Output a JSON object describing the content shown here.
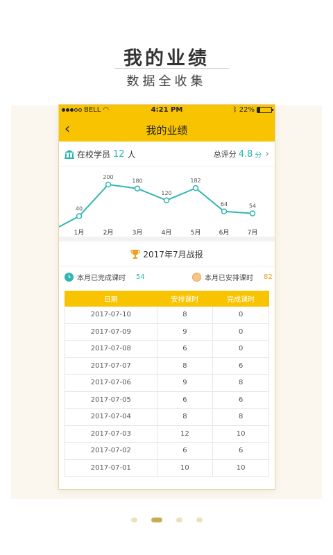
{
  "hero": {
    "title": "我的业绩",
    "subtitle": "数据全收集"
  },
  "status_bar": {
    "carrier": "BELL",
    "time": "4:21 PM",
    "battery": "22%",
    "battery_level": 0.22
  },
  "nav": {
    "title": "我的业绩"
  },
  "summary": {
    "students_label": "在校学员",
    "students_count": "12",
    "students_unit": "人",
    "score_label": "总评分",
    "score_value": "4.8",
    "score_unit": "分"
  },
  "chart_data": {
    "type": "line",
    "categories": [
      "1月",
      "2月",
      "3月",
      "4月",
      "5月",
      "6月",
      "7月"
    ],
    "values": [
      40,
      200,
      180,
      120,
      182,
      64,
      54
    ],
    "color": "#2fb6b0"
  },
  "report": {
    "title": "2017年7月战报"
  },
  "stats": {
    "completed_label": "本月已完成课时",
    "completed_value": "54",
    "scheduled_label": "本月已安排课时",
    "scheduled_value": "82"
  },
  "table": {
    "headers": [
      "日期",
      "安排课时",
      "完成课时"
    ],
    "rows": [
      [
        "2017-07-10",
        "8",
        "0"
      ],
      [
        "2017-07-09",
        "9",
        "0"
      ],
      [
        "2017-07-08",
        "6",
        "0"
      ],
      [
        "2017-07-07",
        "8",
        "6"
      ],
      [
        "2017-07-06",
        "9",
        "8"
      ],
      [
        "2017-07-05",
        "6",
        "6"
      ],
      [
        "2017-07-04",
        "8",
        "8"
      ],
      [
        "2017-07-03",
        "12",
        "10"
      ],
      [
        "2017-07-02",
        "6",
        "6"
      ],
      [
        "2017-07-01",
        "10",
        "10"
      ]
    ]
  },
  "pager": {
    "count": 4,
    "active": 1
  },
  "colors": {
    "accent": "#f8c301",
    "teal": "#2fb6b0",
    "orange": "#f0a020"
  }
}
